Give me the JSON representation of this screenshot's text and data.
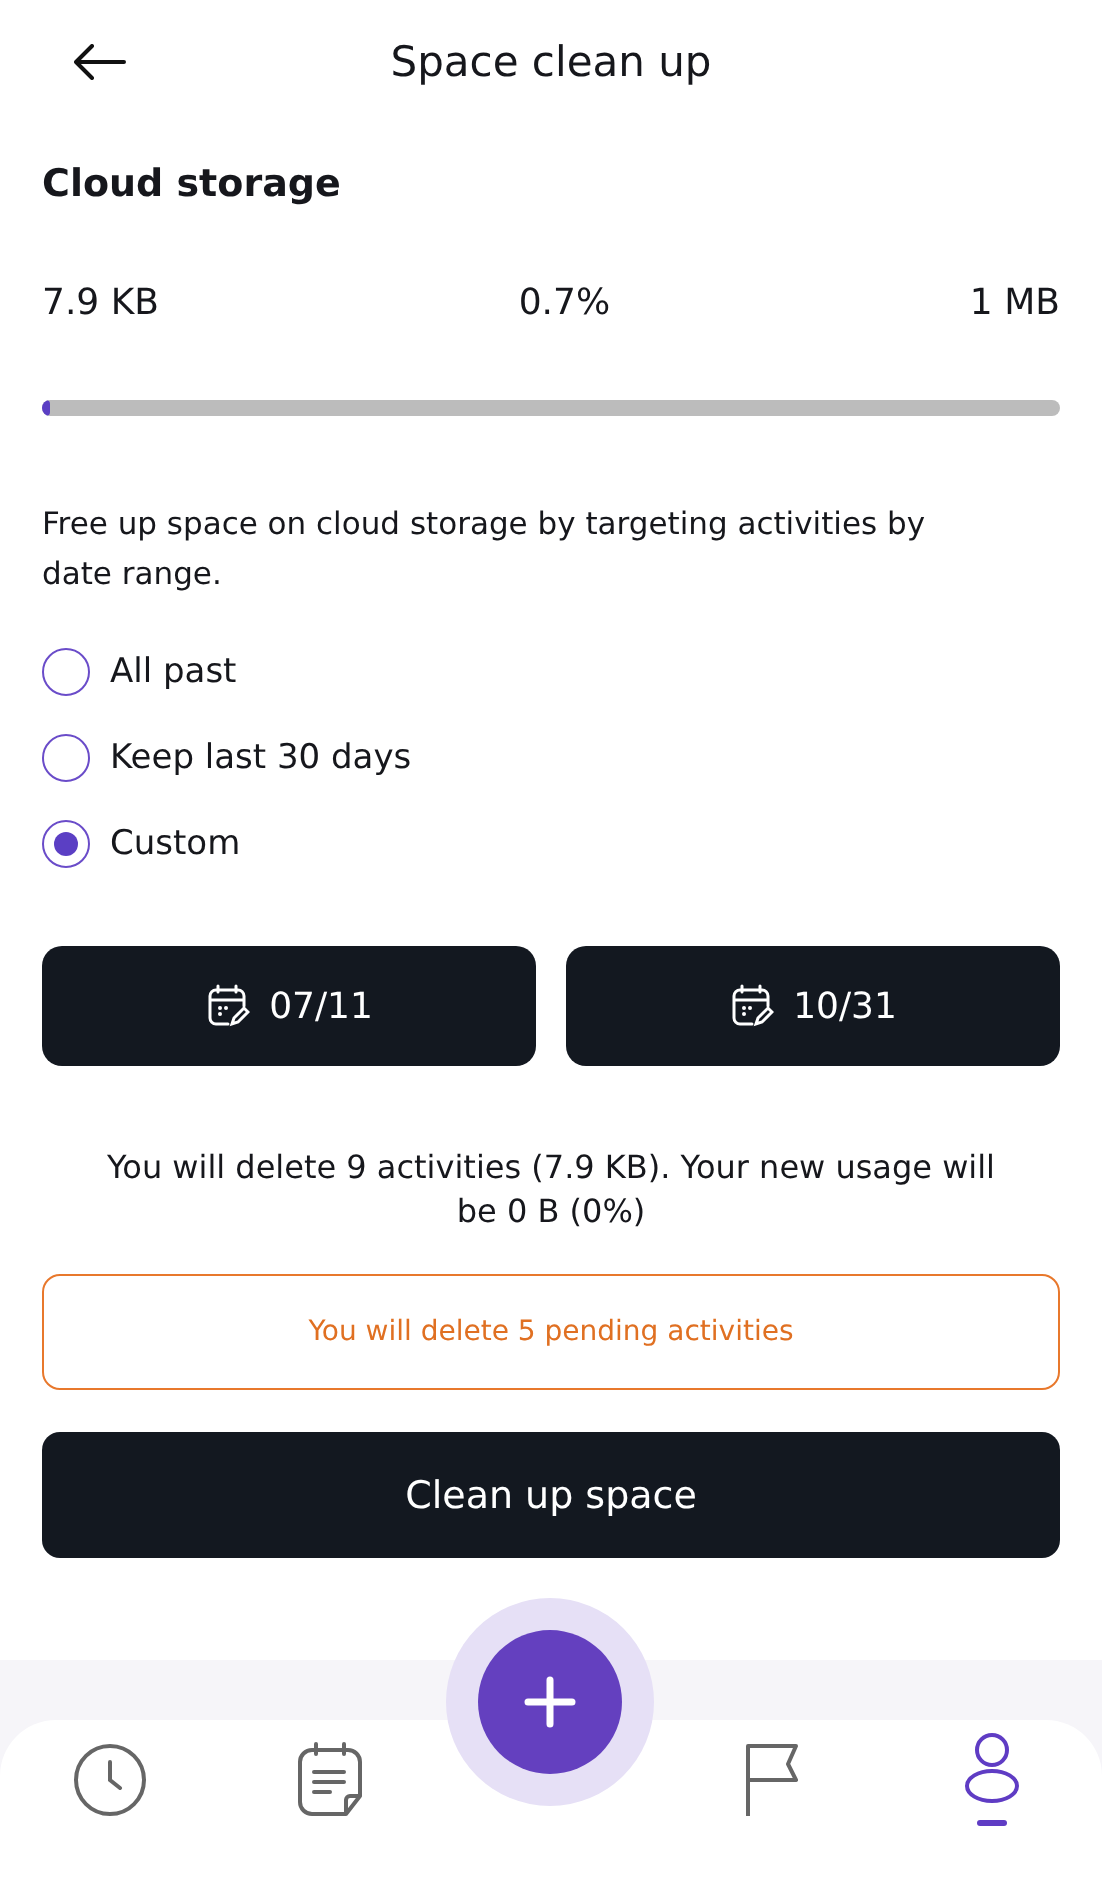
{
  "header": {
    "title": "Space clean up"
  },
  "storage": {
    "title": "Cloud storage",
    "used": "7.9 KB",
    "percent": "0.7%",
    "total": "1 MB",
    "level": 0.007
  },
  "description": "Free up space on cloud storage by targeting activities by date range.",
  "options": [
    {
      "label": "All past",
      "selected": false
    },
    {
      "label": "Keep last 30 days",
      "selected": false
    },
    {
      "label": "Custom",
      "selected": true
    }
  ],
  "dates": [
    "07/11",
    "10/31"
  ],
  "summary": "You will delete 9 activities (7.9 KB). Your new usage will be 0 B (0%)",
  "warning": "You will delete 5 pending activities",
  "action": "Clean up space",
  "nav": [
    {
      "kind": "history",
      "selected": false
    },
    {
      "kind": "notes",
      "selected": false
    },
    {
      "kind": "add",
      "selected": false
    },
    {
      "kind": "flags",
      "selected": false
    },
    {
      "kind": "profile",
      "selected": true
    }
  ]
}
